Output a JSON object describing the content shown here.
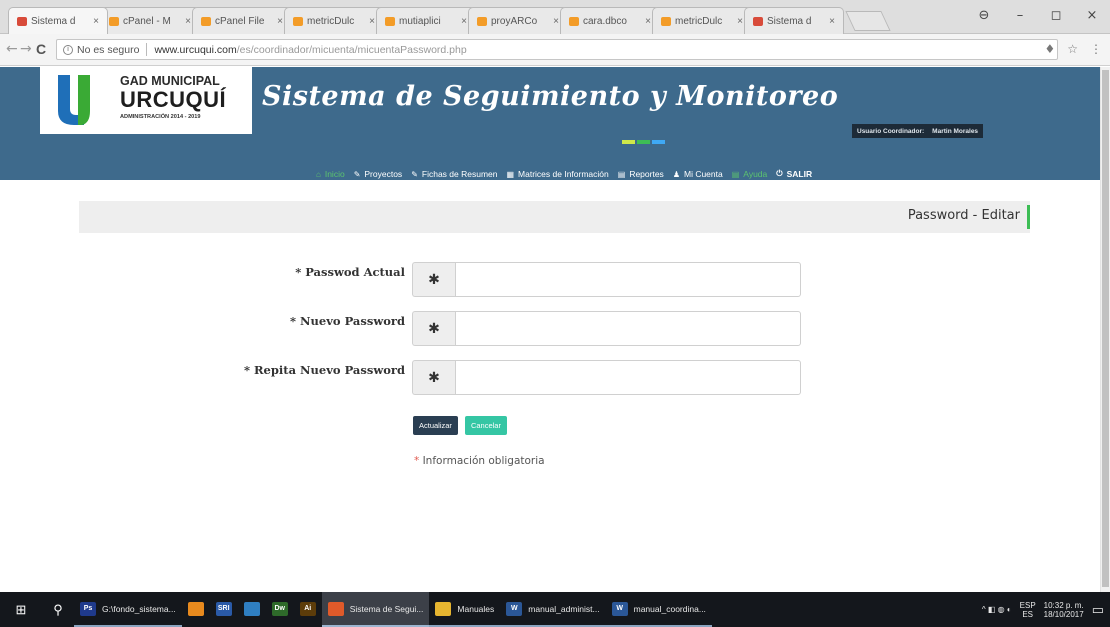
{
  "browser": {
    "tabs": [
      {
        "label": "Sistema d",
        "color": "#d84b3a",
        "active": true
      },
      {
        "label": "cPanel - M",
        "color": "#f39c28"
      },
      {
        "label": "cPanel File",
        "color": "#f39c28"
      },
      {
        "label": "metricDulc",
        "color": "#f39c28"
      },
      {
        "label": "mutiaplici",
        "color": "#f39c28"
      },
      {
        "label": "proyARCo",
        "color": "#f39c28"
      },
      {
        "label": "cara.dbco",
        "color": "#f39c28"
      },
      {
        "label": "metricDulc",
        "color": "#f39c28"
      },
      {
        "label": "Sistema d",
        "color": "#d84b3a"
      }
    ],
    "tab_close": "×",
    "window_controls": {
      "profile": "⊖",
      "minimize": "–",
      "maximize": "◻",
      "close": "×"
    },
    "nav": {
      "back": "←",
      "forward": "→",
      "reload": "C"
    },
    "address": {
      "info_glyph": "i",
      "security": "No es seguro",
      "host": "www.urcuqui.com",
      "path": "/es/coordinador/micuenta/micuentaPassword.php"
    },
    "toolbar_icons": {
      "extension": "♦",
      "star": "☆",
      "menu": "⋮"
    }
  },
  "app": {
    "logo": {
      "line1": "GAD MUNICIPAL",
      "line2": "URCUQUÍ",
      "line3": "ADMINISTRACIÓN 2014 - 2019",
      "u_color_left": "#1f6fb8",
      "u_color_right": "#3aaa35"
    },
    "brand": "Sistema de Seguimiento y Monitoreo",
    "brand_dash_colors": [
      "#cfe84a",
      "#3dbd55",
      "#3fa9f5"
    ],
    "user": {
      "label": "Usuario Coordinador:",
      "name": "Martin Morales"
    },
    "nav": [
      {
        "icon": "home-icon",
        "glyph": "⌂",
        "label": "Inicio",
        "active": true
      },
      {
        "icon": "pencil-icon",
        "glyph": "✎",
        "label": "Proyectos"
      },
      {
        "icon": "pencil-icon",
        "glyph": "✎",
        "label": "Fichas de Resumen"
      },
      {
        "icon": "calendar-icon",
        "glyph": "▦",
        "label": "Matrices de Información"
      },
      {
        "icon": "file-icon",
        "glyph": "▤",
        "label": "Reportes"
      },
      {
        "icon": "user-icon",
        "glyph": "♟",
        "label": "Mi Cuenta"
      },
      {
        "icon": "help-icon",
        "glyph": "▤",
        "label": "Ayuda",
        "active": true
      },
      {
        "icon": "power-icon",
        "glyph": "⏻",
        "label": "SALIR"
      }
    ],
    "page_title": "Password - Editar",
    "accent_color": "#3dbd55"
  },
  "form": {
    "fields": [
      {
        "label": "* Passwod Actual",
        "addon": "✱",
        "value": ""
      },
      {
        "label": "* Nuevo Password",
        "addon": "✱",
        "value": ""
      },
      {
        "label": "* Repita Nuevo Password",
        "addon": "✱",
        "value": ""
      }
    ],
    "buttons": {
      "update": "Actualizar",
      "cancel": "Cancelar"
    },
    "required_note_star": "*",
    "required_note": " Información obligatoria"
  },
  "taskbar": {
    "start_glyph": "⊞",
    "search_glyph": "⚲",
    "apps": [
      {
        "label": "G:\\fondo_sistema...",
        "badge": "Ps",
        "color": "#1f3a8c",
        "labeled": true
      },
      {
        "label": "",
        "badge": "",
        "color": "#e88a1e"
      },
      {
        "label": "",
        "badge": "SRI",
        "color": "#2a5aa8"
      },
      {
        "label": "",
        "badge": "",
        "color": "#2f7fc2"
      },
      {
        "label": "",
        "badge": "Dw",
        "color": "#2e6a2a"
      },
      {
        "label": "",
        "badge": "Ai",
        "color": "#5c3c0a"
      },
      {
        "label": "Sistema de Segui...",
        "badge": "",
        "color": "#e05a2a",
        "active": true,
        "labeled": true
      },
      {
        "label": "Manuales",
        "badge": "",
        "color": "#e6b530",
        "labeled": true
      },
      {
        "label": "manual_administ...",
        "badge": "W",
        "color": "#2b5797",
        "labeled": true
      },
      {
        "label": "manual_coordina...",
        "badge": "W",
        "color": "#2b5797",
        "labeled": true
      }
    ],
    "tray": {
      "icons": "^ ◧ ◍ ◐",
      "lang_top": "ESP",
      "lang_bottom": "ES",
      "time": "10:32 p. m.",
      "date": "18/10/2017",
      "notification_glyph": "▭"
    }
  }
}
